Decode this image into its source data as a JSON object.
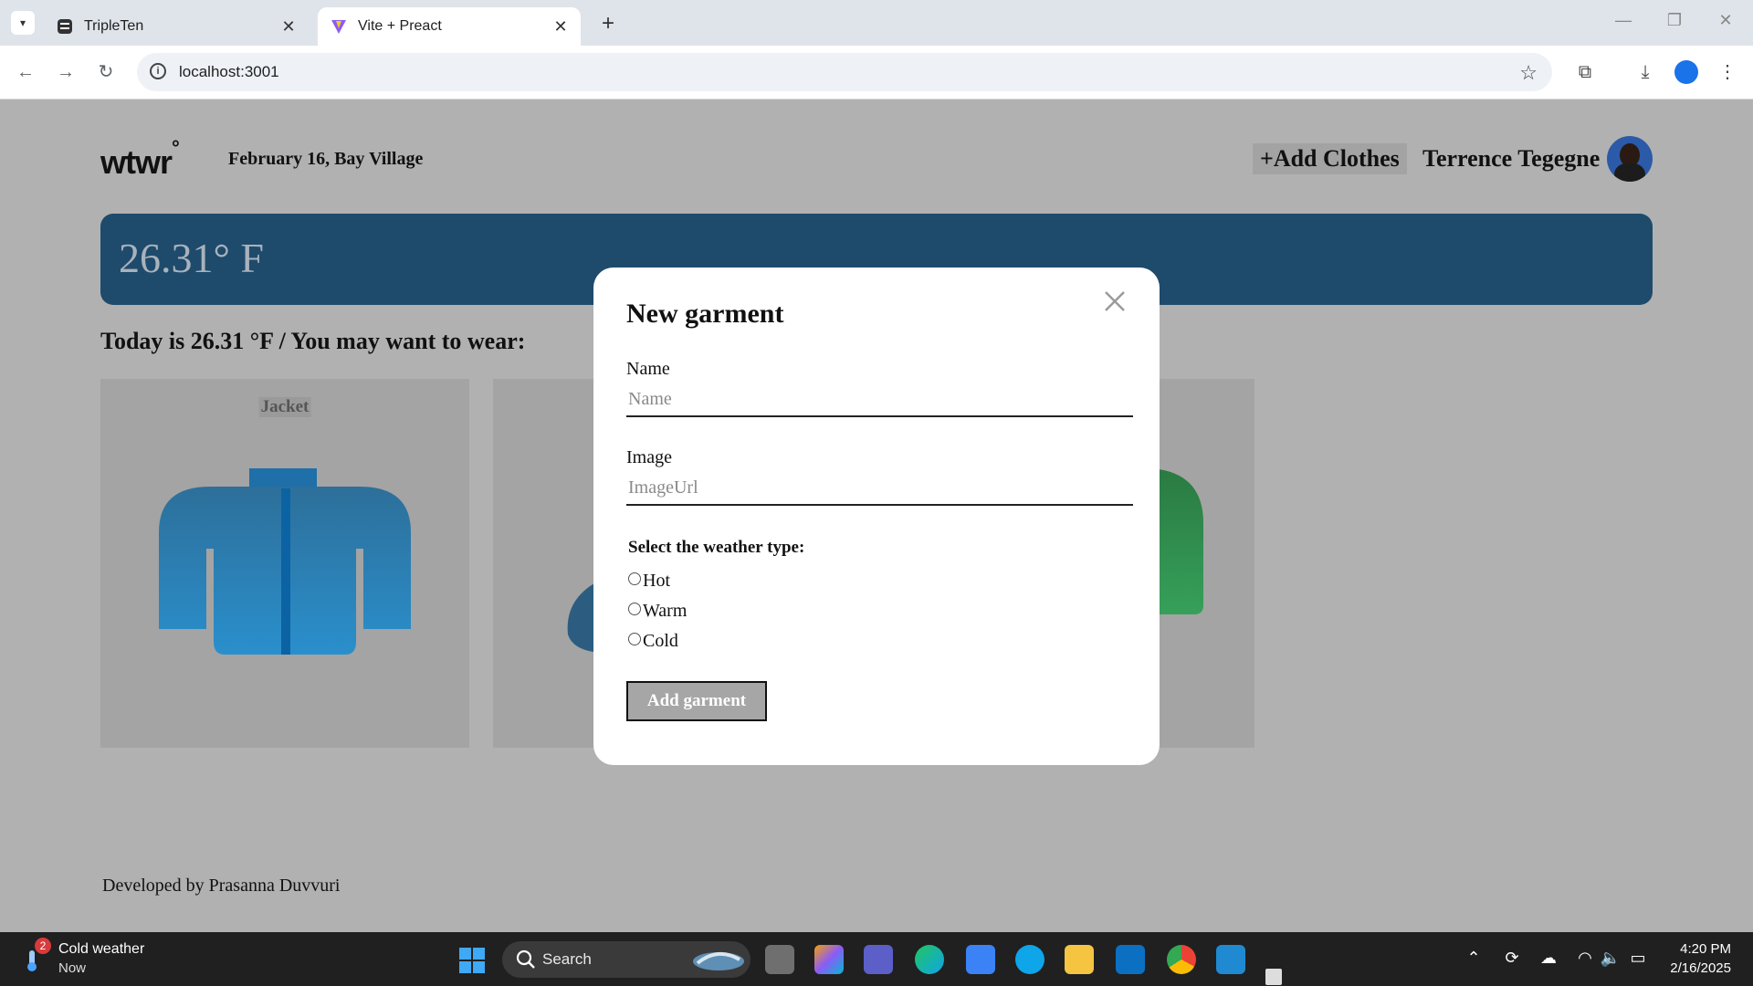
{
  "browser": {
    "tabs": [
      {
        "title": "TripleTen",
        "active": false
      },
      {
        "title": "Vite + Preact",
        "active": true
      }
    ],
    "url": "localhost:3001"
  },
  "header": {
    "logo": "wtwr",
    "logo_mark": "°",
    "date_location": "February 16, Bay Village",
    "add_clothes_label": "+Add Clothes",
    "username": "Terrence Tegegne"
  },
  "weather": {
    "temperature_display": "26.31° F",
    "today_text": "Today is 26.31 °F / You may want to wear:",
    "card_color": "#1e4b6c"
  },
  "items": [
    {
      "name": "Jacket",
      "icon": "jacket-icon",
      "color": "#2a82ba"
    },
    {
      "name": "",
      "icon": "hat-icon",
      "color": "#2c5d80"
    },
    {
      "name": "",
      "icon": "sweater-icon",
      "color": "#2f8c4a"
    }
  ],
  "modal": {
    "title": "New garment",
    "name_label": "Name",
    "name_placeholder": "Name",
    "image_label": "Image",
    "image_placeholder": "ImageUrl",
    "weather_legend": "Select the weather type:",
    "options": [
      "Hot",
      "Warm",
      "Cold"
    ],
    "submit_label": "Add garment"
  },
  "footer": {
    "credit": "Developed by Prasanna Duvvuri"
  },
  "taskbar": {
    "weather_title": "Cold weather",
    "weather_sub": "Now",
    "notification_count": "2",
    "search_label": "Search",
    "time": "4:20 PM",
    "date": "2/16/2025"
  }
}
